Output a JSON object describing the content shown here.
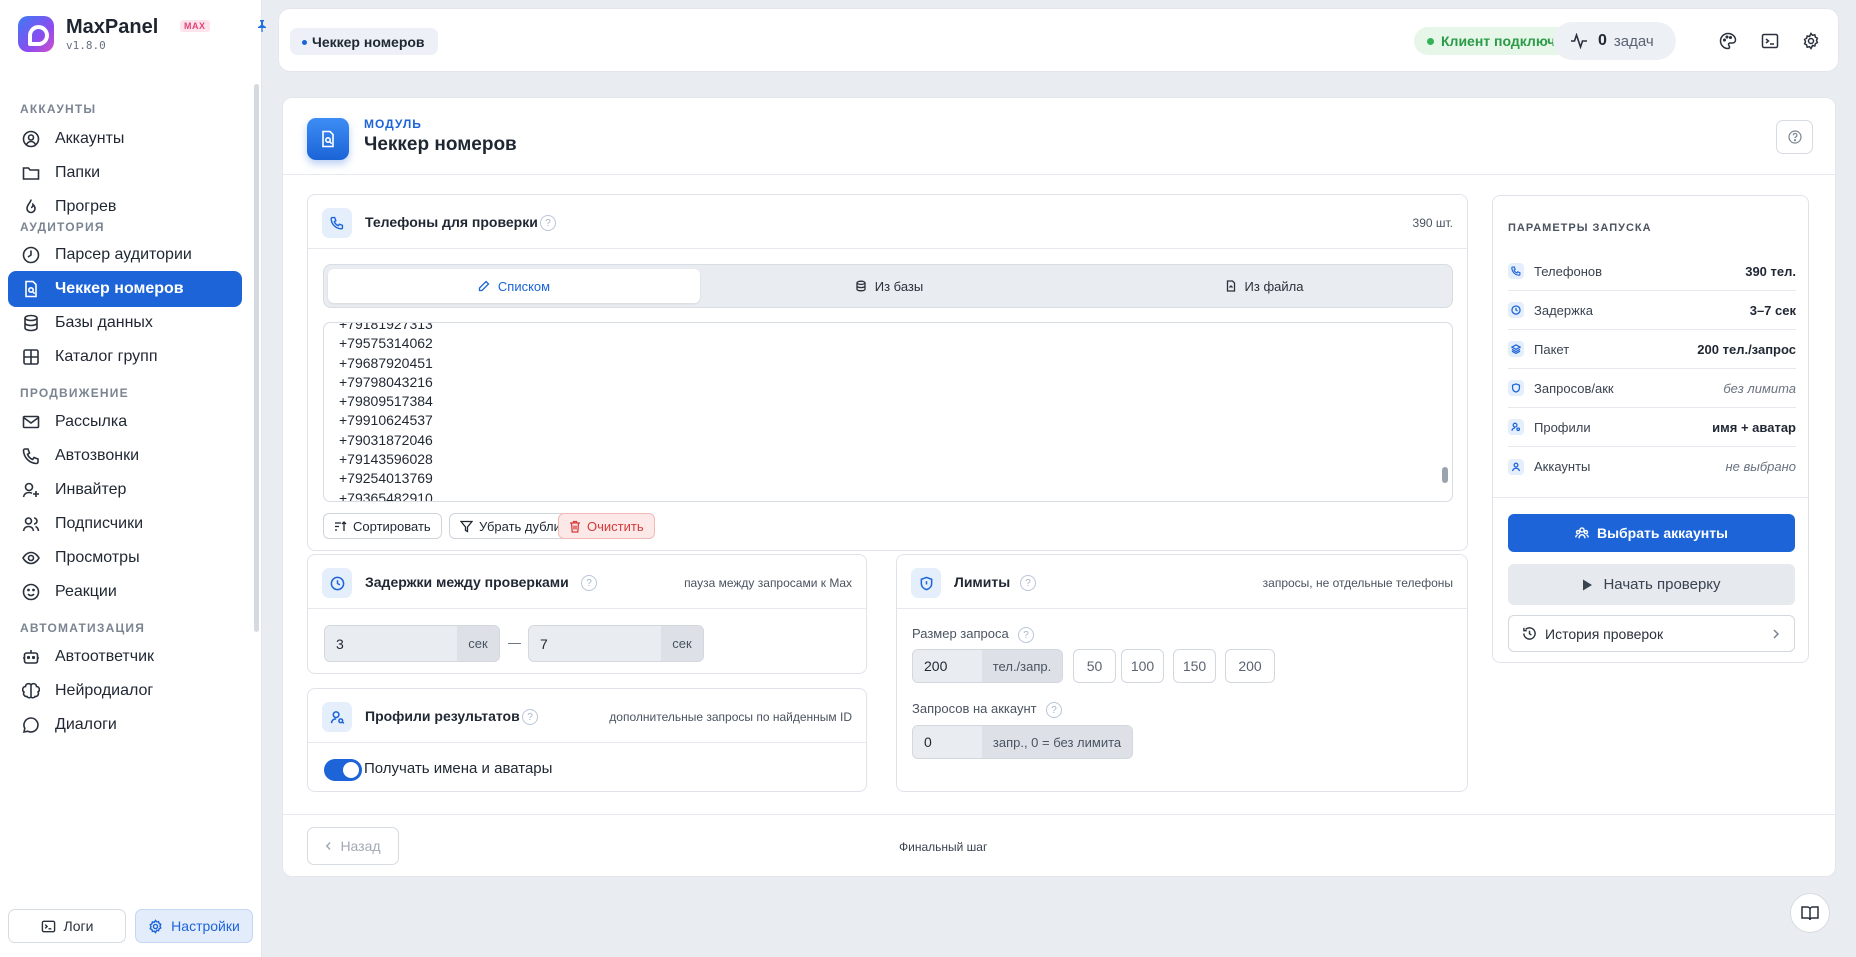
{
  "app": {
    "name": "MaxPanel",
    "badge": "MAX",
    "version": "v1.8.0"
  },
  "sidebar": {
    "sections": [
      {
        "label": "АККАУНТЫ",
        "items": [
          {
            "label": "Аккаунты",
            "icon": "user-circle-icon"
          },
          {
            "label": "Папки",
            "icon": "folder-icon"
          },
          {
            "label": "Прогрев",
            "icon": "flame-icon"
          }
        ]
      },
      {
        "label": "АУДИТОРИЯ",
        "items": [
          {
            "label": "Парсер аудитории",
            "icon": "history-icon"
          },
          {
            "label": "Чеккер номеров",
            "icon": "file-search-icon",
            "active": true
          },
          {
            "label": "Базы данных",
            "icon": "database-icon"
          },
          {
            "label": "Каталог групп",
            "icon": "grid-icon"
          }
        ]
      },
      {
        "label": "ПРОДВИЖЕНИЕ",
        "items": [
          {
            "label": "Рассылка",
            "icon": "mail-send-icon"
          },
          {
            "label": "Автозвонки",
            "icon": "phone-icon"
          },
          {
            "label": "Инвайтер",
            "icon": "user-plus-icon"
          },
          {
            "label": "Подписчики",
            "icon": "users-icon"
          },
          {
            "label": "Просмотры",
            "icon": "eye-icon"
          },
          {
            "label": "Реакции",
            "icon": "smile-icon"
          }
        ]
      },
      {
        "label": "АВТОМАТИЗАЦИЯ",
        "items": [
          {
            "label": "Автоответчик",
            "icon": "bot-icon"
          },
          {
            "label": "Нейродиалог",
            "icon": "brain-icon"
          },
          {
            "label": "Диалоги",
            "icon": "chat-icon"
          }
        ]
      }
    ],
    "logs_label": "Логи",
    "settings_label": "Настройки"
  },
  "topbar": {
    "breadcrumb": "Чеккер номеров",
    "status": "Клиент подключён",
    "tasks_count": "0",
    "tasks_label": "задач"
  },
  "module": {
    "label": "МОДУЛЬ",
    "title": "Чеккер номеров"
  },
  "phones_panel": {
    "title": "Телефоны для проверки",
    "count": "390 шт.",
    "tabs": [
      {
        "label": "Списком",
        "icon": "pencil-icon"
      },
      {
        "label": "Из базы",
        "icon": "database-icon"
      },
      {
        "label": "Из файла",
        "icon": "file-icon"
      }
    ],
    "phones": [
      "+79181927313",
      "+79575314062",
      "+79687920451",
      "+79798043216",
      "+79809517384",
      "+79910624537",
      "+79031872046",
      "+79143596028",
      "+79254013769",
      "+79365482910"
    ],
    "sort_label": "Сортировать",
    "dedupe_label": "Убрать дубли",
    "clear_label": "Очистить"
  },
  "delay_panel": {
    "title": "Задержки между проверками",
    "note": "пауза между запросами к Max",
    "min": "3",
    "max": "7",
    "unit": "сек",
    "sep": "—"
  },
  "profiles_panel": {
    "title": "Профили результатов",
    "note": "дополнительные запросы по найденным ID",
    "toggle_label": "Получать имена и аватары",
    "toggle_on": true
  },
  "limits_panel": {
    "title": "Лимиты",
    "note": "запросы, не отдельные телефоны",
    "request_size_label": "Размер запроса",
    "request_size": "200",
    "request_unit": "тел./запр.",
    "presets": [
      "50",
      "100",
      "150",
      "200"
    ],
    "per_account_label": "Запросов на аккаунт",
    "per_account": "0",
    "per_account_unit": "запр., 0 = без лимита"
  },
  "params": {
    "title": "ПАРАМЕТРЫ ЗАПУСКА",
    "rows": [
      {
        "label": "Телефонов",
        "value": "390 тел.",
        "icon": "phone-icon",
        "muted": false
      },
      {
        "label": "Задержка",
        "value": "3–7 сек",
        "icon": "clock-icon",
        "muted": false
      },
      {
        "label": "Пакет",
        "value": "200 тел./запрос",
        "icon": "layers-icon",
        "muted": false
      },
      {
        "label": "Запросов/акк",
        "value": "без лимита",
        "icon": "shield-icon",
        "muted": true
      },
      {
        "label": "Профили",
        "value": "имя + аватар",
        "icon": "user-search-icon",
        "muted": false
      },
      {
        "label": "Аккаунты",
        "value": "не выбрано",
        "icon": "user-icon",
        "muted": true
      }
    ],
    "select_accounts": "Выбрать аккаунты",
    "start": "Начать проверку",
    "history": "История проверок"
  },
  "footer": {
    "back": "Назад",
    "step": "Финальный шаг"
  }
}
